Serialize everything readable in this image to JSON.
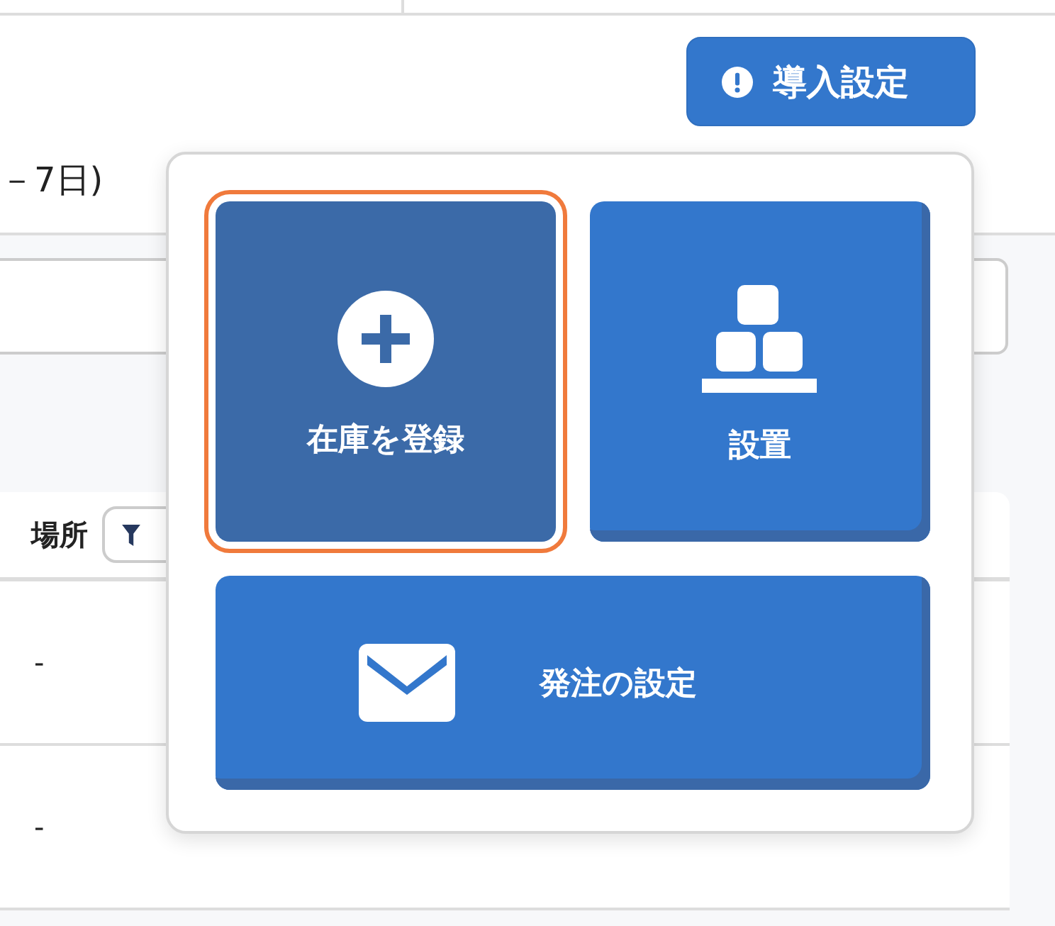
{
  "header": {
    "setup_button": {
      "label": "導入設定"
    }
  },
  "period_label": "－7日)",
  "table": {
    "columns": [
      {
        "label": "場所"
      }
    ],
    "rows": [
      {
        "cell": "-"
      },
      {
        "cell": "-"
      }
    ]
  },
  "menu": {
    "tiles": [
      {
        "label": "在庫を登録",
        "kind": "add",
        "selected": true
      },
      {
        "label": "設置",
        "kind": "place",
        "selected": false
      },
      {
        "label": "発注の設定",
        "kind": "order",
        "selected": false
      }
    ]
  }
}
